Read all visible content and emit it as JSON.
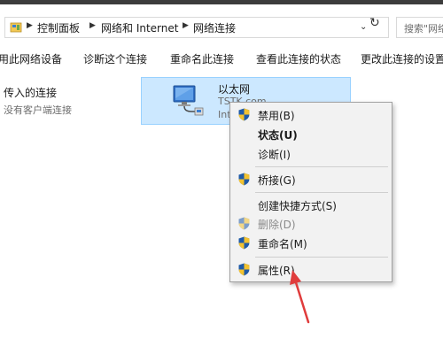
{
  "address_bar": {
    "crumbs": [
      "控制面板",
      "网络和 Internet",
      "网络连接"
    ],
    "dropdown_icon": "chevron-down-icon",
    "refresh_icon": "refresh-icon"
  },
  "search": {
    "placeholder": "搜索\"网络连"
  },
  "command_bar": {
    "items": [
      "用此网络设备",
      "诊断这个连接",
      "重命名此连接",
      "查看此连接的状态",
      "更改此连接的设置"
    ]
  },
  "incoming": {
    "title": "传入的连接",
    "subtitle": "没有客户端连接"
  },
  "adapter": {
    "name": "以太网",
    "domain": "TSTK.com",
    "device": "Int"
  },
  "context_menu": {
    "items": [
      {
        "label": "禁用(B)",
        "icon": "shield-icon",
        "bold": false,
        "disabled": false
      },
      {
        "label": "状态(U)",
        "icon": "",
        "bold": true,
        "disabled": false
      },
      {
        "label": "诊断(I)",
        "icon": "",
        "bold": false,
        "disabled": false
      },
      {
        "label": "桥接(G)",
        "icon": "shield-icon",
        "bold": false,
        "disabled": false
      },
      {
        "label": "创建快捷方式(S)",
        "icon": "",
        "bold": false,
        "disabled": false
      },
      {
        "label": "删除(D)",
        "icon": "shield-icon",
        "bold": false,
        "disabled": true
      },
      {
        "label": "重命名(M)",
        "icon": "shield-icon",
        "bold": false,
        "disabled": false
      },
      {
        "label": "属性(R)",
        "icon": "shield-icon",
        "bold": false,
        "disabled": false
      }
    ]
  },
  "colors": {
    "selection_fill": "#cce8ff",
    "selection_border": "#99d1ff",
    "menu_background": "#f2f2f2",
    "annotation_arrow": "#e03c3c"
  }
}
